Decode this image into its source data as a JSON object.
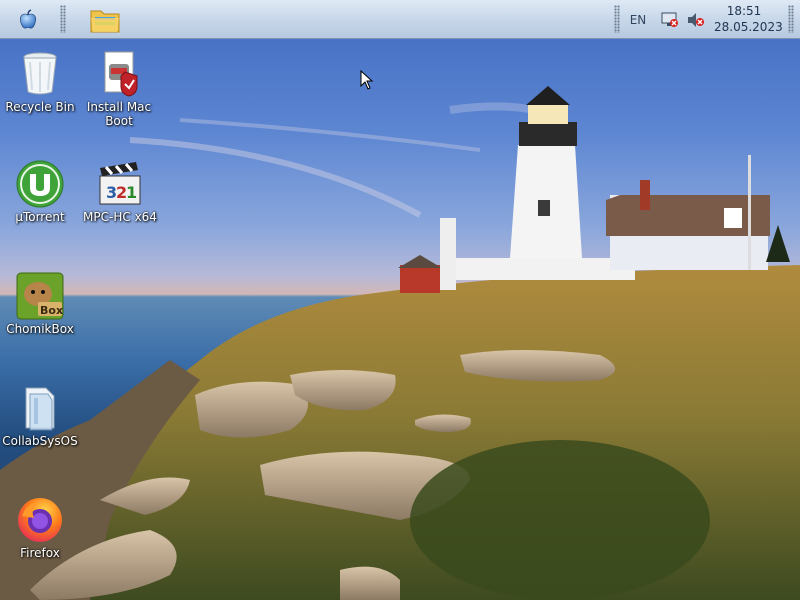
{
  "taskbar": {
    "language": "EN",
    "clock_time": "18:51",
    "clock_date": "28.05.2023"
  },
  "desktop_icons": [
    {
      "label": "Recycle Bin",
      "icon": "recycle-bin-icon"
    },
    {
      "label": "Install Mac\nBoot",
      "icon": "installer-shield-icon"
    },
    {
      "label": "µTorrent",
      "icon": "utorrent-icon"
    },
    {
      "label": "MPC-HC x64",
      "icon": "mpc-hc-clapperboard-icon"
    },
    {
      "label": "ChomikBox",
      "icon": "chomikbox-hamster-icon"
    },
    {
      "label": "CollabSysOS",
      "icon": "folder-document-icon"
    },
    {
      "label": "Firefox",
      "icon": "firefox-icon"
    }
  ],
  "colors": {
    "taskbar_top": "#dfe9f5",
    "taskbar_bottom": "#b7c9df",
    "utorrent_green": "#3fa33a",
    "firefox_orange": "#ff7a1a"
  }
}
